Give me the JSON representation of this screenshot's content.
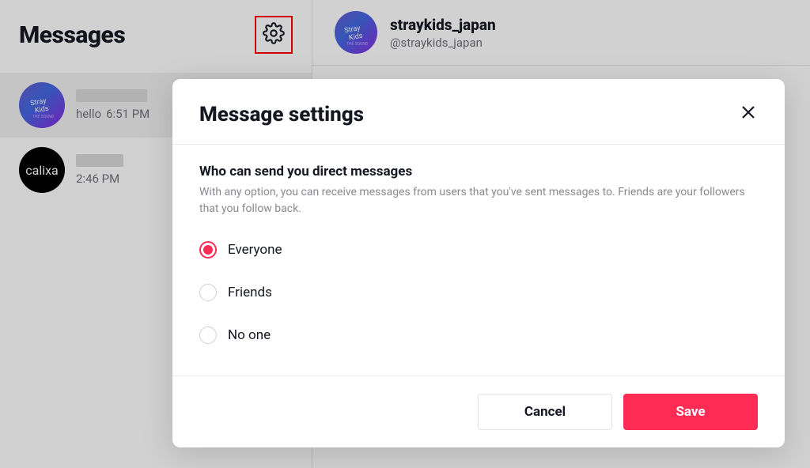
{
  "sidebar": {
    "title": "Messages",
    "conversations": [
      {
        "preview_message": "hello",
        "preview_time": "6:51 PM",
        "avatar_kind": "straykids"
      },
      {
        "preview_message": "",
        "preview_time": "2:46 PM",
        "avatar_kind": "calixa",
        "avatar_text": "calixa"
      }
    ]
  },
  "chat": {
    "display_name": "straykids_japan",
    "handle": "@straykids_japan"
  },
  "modal": {
    "title": "Message settings",
    "section_title": "Who can send you direct messages",
    "section_desc": "With any option, you can receive messages from users that you've sent messages to. Friends are your followers that you follow back.",
    "options": [
      {
        "label": "Everyone",
        "checked": true
      },
      {
        "label": "Friends",
        "checked": false
      },
      {
        "label": "No one",
        "checked": false
      }
    ],
    "buttons": {
      "cancel": "Cancel",
      "save": "Save"
    }
  },
  "colors": {
    "accent": "#fe2c55"
  }
}
